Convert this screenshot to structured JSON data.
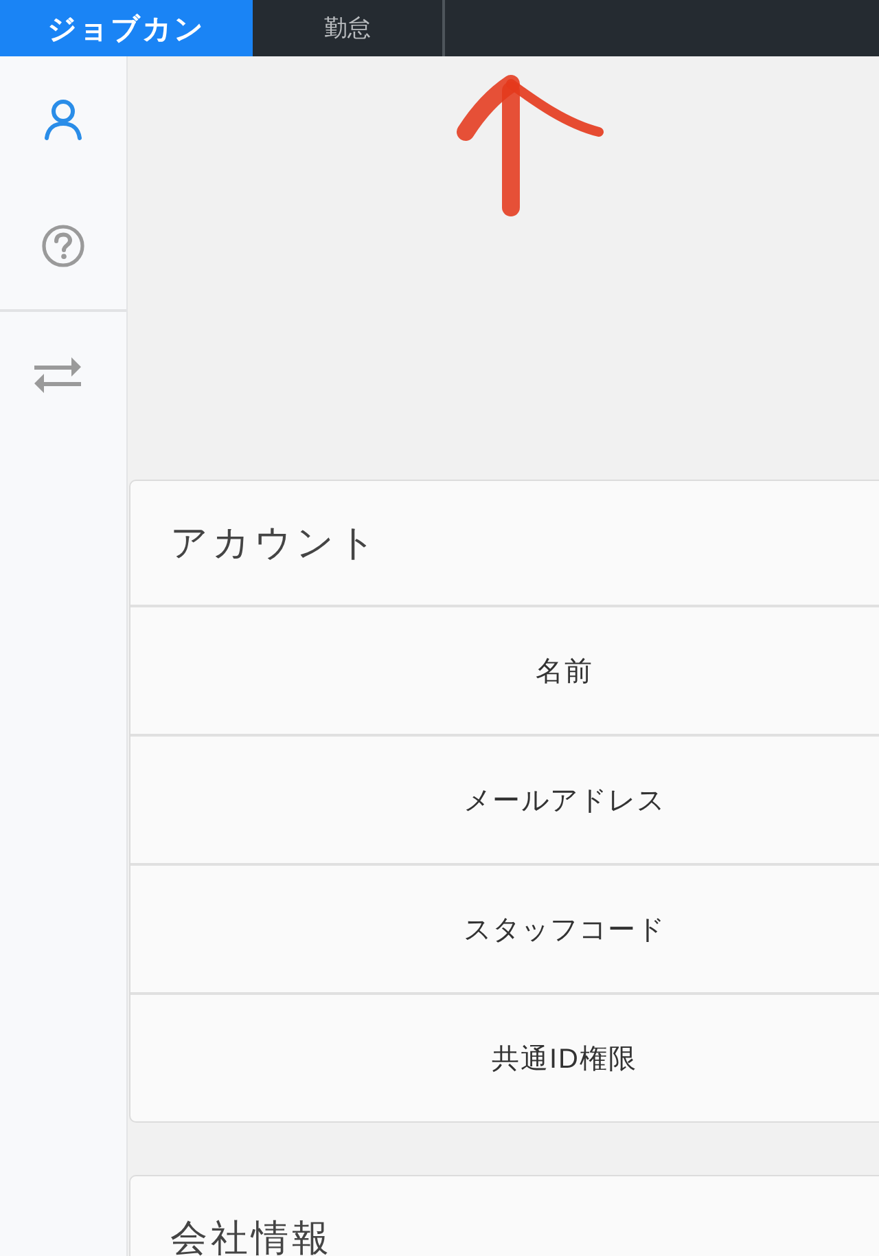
{
  "top_bar": {
    "brand": "ジョブカン",
    "service": "勤怠"
  },
  "sidebar": {
    "sections": [
      {
        "items": [
          {
            "kind": "user",
            "selected": true
          },
          {
            "kind": "help",
            "selected": false
          }
        ]
      },
      {
        "items": [
          {
            "kind": "switch",
            "selected": false
          }
        ]
      }
    ]
  },
  "sections": [
    {
      "title": "アカウント",
      "rows": [
        "名前",
        "メールアドレス",
        "スタッフコード",
        "共通ID権限"
      ]
    },
    {
      "title": "会社情報"
    }
  ]
}
